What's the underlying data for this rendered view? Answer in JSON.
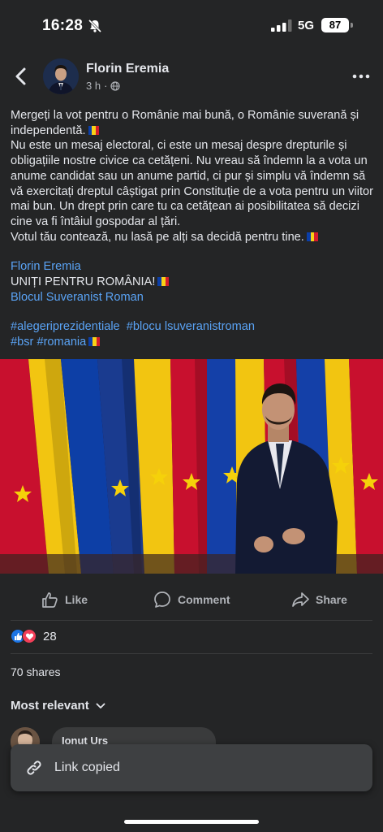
{
  "status_bar": {
    "time": "16:28",
    "network": "5G",
    "battery": "87"
  },
  "post": {
    "author": "Florin Eremia",
    "time_ago": "3 h",
    "separator": "·",
    "paragraphs": [
      "Mergeți la vot pentru o Românie mai bună, o Românie suverană și independentă.",
      "Nu este un mesaj electoral, ci este un mesaj despre drepturile și obligațiile nostre civice ca cetățeni. Nu vreau să îndemn la a vota un anume candidat sau un anume partid, ci pur și simplu vă îndemn să vă exercitați dreptul câștigat prin Constituție de a vota pentru un viitor mai bun. Un drept prin care tu ca cetățean ai posibilitatea să decizi cine va fi întâiul gospodar al țări.",
      "Votul tău contează, nu lasă pe alți sa decidă pentru tine."
    ],
    "signature_name": "Florin Eremia",
    "slogan": "UNIȚI PENTRU ROMÂNIA!",
    "organization": "Blocul Suveranist Roman",
    "hashtags_line1": "#alegeriprezidentiale  #blocu lsuveranistroman",
    "hashtag_1": "#alegeriprezidentiale",
    "hashtag_2": "#blocu lsuveranistroman",
    "hashtag_3": "#bsr",
    "hashtag_4": "#romania"
  },
  "actions": {
    "like": "Like",
    "comment": "Comment",
    "share": "Share"
  },
  "engagement": {
    "reactions_count": "28",
    "shares": "70 shares",
    "sort_label": "Most relevant"
  },
  "comment": {
    "author": "Ionut Urs"
  },
  "toast": {
    "text": "Link copied"
  },
  "colors": {
    "background": "#242526",
    "link": "#5aa3f5",
    "like_blue": "#1b74e4",
    "love_red": "#f33e58"
  }
}
